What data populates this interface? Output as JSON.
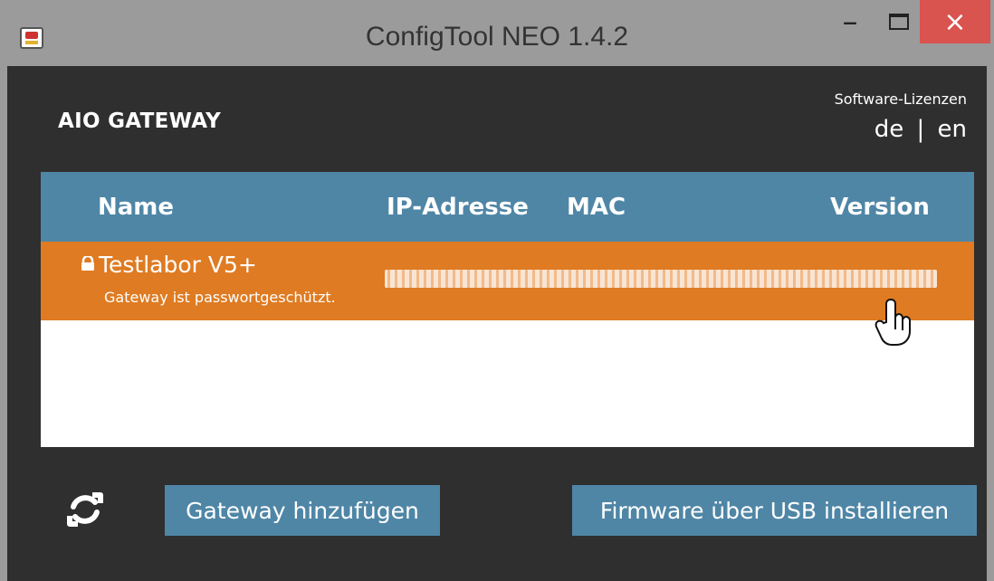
{
  "window": {
    "title": "ConfigTool NEO 1.4.2",
    "buttons": {
      "minimize": "–",
      "maximize": "□",
      "close": "×"
    }
  },
  "header": {
    "brand": "AIO GATEWAY",
    "licenses": "Software-Lizenzen",
    "lang": {
      "de": "de",
      "separator": "|",
      "en": "en"
    }
  },
  "table": {
    "columns": [
      "Name",
      "IP-Adresse",
      "MAC",
      "Version"
    ],
    "rows": [
      {
        "name": "Testlabor V5+",
        "status": "Gateway ist passwortgeschützt."
      }
    ]
  },
  "actions": {
    "add_gateway": "Gateway hinzufügen",
    "install_firmware": "Firmware über USB installieren"
  },
  "colors": {
    "accent": "#4f86a6",
    "selected_row": "#df7b22",
    "background": "#2f2f2f",
    "close": "#d9534f"
  },
  "icons": {
    "app": "app-icon",
    "lock": "lock-icon",
    "cursor": "hand-cursor-icon",
    "refresh": "refresh-icon"
  }
}
